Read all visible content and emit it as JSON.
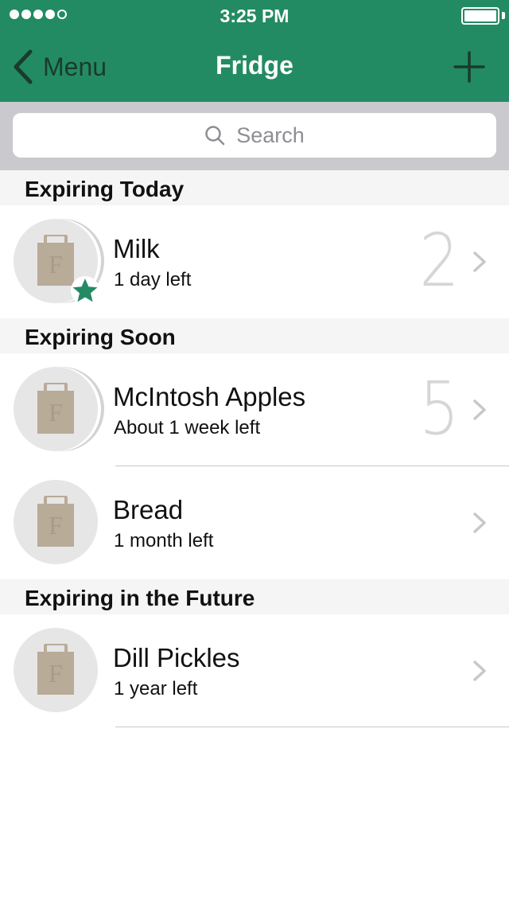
{
  "status_bar": {
    "time": "3:25 PM",
    "signal_bars_filled": 4,
    "signal_bars_total": 5
  },
  "nav": {
    "back_label": "Menu",
    "title": "Fridge",
    "add_icon": "plus-icon",
    "back_icon": "chevron-left-icon"
  },
  "search": {
    "placeholder": "Search",
    "icon": "search-icon"
  },
  "colors": {
    "header": "#238b64",
    "accent_star": "#238b64",
    "section_bg": "#f5f5f5",
    "search_bar_bg": "#c9c9ce",
    "item_icon": "#b8ab98"
  },
  "sections": [
    {
      "title": "Expiring Today",
      "items": [
        {
          "name": "Milk",
          "subtitle": "1 day left",
          "count": "2",
          "starred": true
        }
      ]
    },
    {
      "title": "Expiring Soon",
      "items": [
        {
          "name": "McIntosh Apples",
          "subtitle": "About 1 week left",
          "count": "5",
          "starred": false
        },
        {
          "name": "Bread",
          "subtitle": "1 month left",
          "count": "",
          "starred": false
        }
      ]
    },
    {
      "title": "Expiring in the Future",
      "items": [
        {
          "name": "Dill Pickles",
          "subtitle": "1 year left",
          "count": "",
          "starred": false
        }
      ]
    }
  ]
}
